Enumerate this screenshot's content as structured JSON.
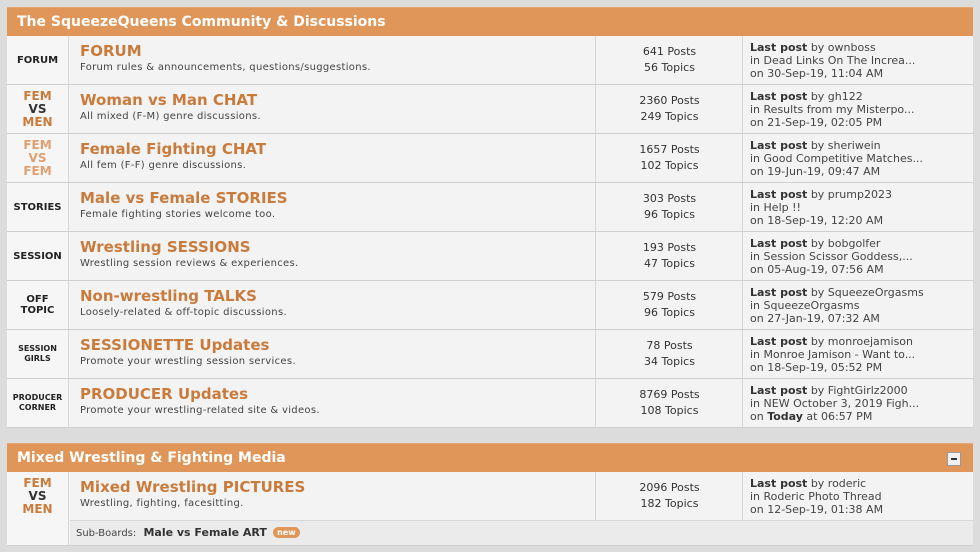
{
  "categories": [
    {
      "title": "The SqueezeQueens Community & Discussions",
      "boards": [
        {
          "icon": [
            "FORUM"
          ],
          "icon_style": "text",
          "title": "FORUM",
          "desc": "Forum rules & announcements, questions/suggestions.",
          "posts": "641 Posts",
          "topics": "56 Topics",
          "last_label": "Last post",
          "by": "by ownboss",
          "in": "in Dead Links On The Increa...",
          "on": "on 30-Sep-19, 11:04 AM"
        },
        {
          "icon": [
            "FEM",
            "VS",
            "MEN"
          ],
          "icon_style": "fem-orange",
          "title": "Woman vs Man CHAT",
          "desc": "All mixed (F-M) genre discussions.",
          "posts": "2360 Posts",
          "topics": "249 Topics",
          "last_label": "Last post",
          "by": "by gh122",
          "in": "in Results from my Misterpo...",
          "on": "on 21-Sep-19, 02:05 PM"
        },
        {
          "icon": [
            "FEM",
            "VS",
            "FEM"
          ],
          "icon_style": "fem-light",
          "title": "Female Fighting CHAT",
          "desc": "All fem (F-F) genre discussions.",
          "posts": "1657 Posts",
          "topics": "102 Topics",
          "last_label": "Last post",
          "by": "by sheriwein",
          "in": "in Good Competitive Matches...",
          "on": "on 19-Jun-19, 09:47 AM"
        },
        {
          "icon": [
            "STORIES"
          ],
          "icon_style": "text",
          "title": "Male vs Female STORIES",
          "desc": "Female fighting stories welcome too.",
          "posts": "303 Posts",
          "topics": "96 Topics",
          "last_label": "Last post",
          "by": "by prump2023",
          "in": "in Help !!",
          "on": "on 18-Sep-19, 12:20 AM"
        },
        {
          "icon": [
            "SESSION"
          ],
          "icon_style": "text",
          "title": "Wrestling SESSIONS",
          "desc": "Wrestling session reviews & experiences.",
          "posts": "193 Posts",
          "topics": "47 Topics",
          "last_label": "Last post",
          "by": "by bobgolfer",
          "in": "in Session Scissor Goddess,...",
          "on": "on 05-Aug-19, 07:56 AM"
        },
        {
          "icon": [
            "OFF",
            "TOPIC"
          ],
          "icon_style": "text",
          "title": "Non-wrestling TALKS",
          "desc": "Loosely-related & off-topic discussions.",
          "posts": "579 Posts",
          "topics": "96 Topics",
          "last_label": "Last post",
          "by": "by SqueezeOrgasms",
          "in": "in SqueezeOrgasms",
          "on": "on 27-Jan-19, 07:32 AM"
        },
        {
          "icon": [
            "SESSION",
            "GIRLS"
          ],
          "icon_style": "small",
          "title": "SESSIONETTE Updates",
          "desc": "Promote your wrestling session services.",
          "posts": "78 Posts",
          "topics": "34 Topics",
          "last_label": "Last post",
          "by": "by monroejamison",
          "in": "in Monroe Jamison - Want to...",
          "on": "on 18-Sep-19, 05:52 PM"
        },
        {
          "icon": [
            "PRODUCER",
            "CORNER"
          ],
          "icon_style": "small",
          "title": "PRODUCER Updates",
          "desc": "Promote your wrestling-related site & videos.",
          "posts": "8769 Posts",
          "topics": "108 Topics",
          "last_label": "Last post",
          "by": "by FightGirlz2000",
          "in": "in NEW October 3, 2019 Figh...",
          "on_prefix": "on ",
          "on_bold": "Today",
          "on_suffix": " at 06:57 PM"
        }
      ]
    },
    {
      "title": "Mixed Wrestling & Fighting Media",
      "boards": [
        {
          "icon": [
            "FEM",
            "VS",
            "MEN"
          ],
          "icon_style": "fem-orange",
          "title": "Mixed Wrestling PICTURES",
          "desc": "Wrestling, fighting, facesitting.",
          "posts": "2096 Posts",
          "topics": "182 Topics",
          "last_label": "Last post",
          "by": "by roderic",
          "in": "in Roderic Photo Thread",
          "on": "on 12-Sep-19, 01:38 AM",
          "subboards_label": "Sub-Boards:",
          "subboard": "Male vs Female ART",
          "subboard_badge": "new"
        }
      ]
    }
  ],
  "colors": {
    "header": "#e09658",
    "title": "#c97b3c"
  }
}
